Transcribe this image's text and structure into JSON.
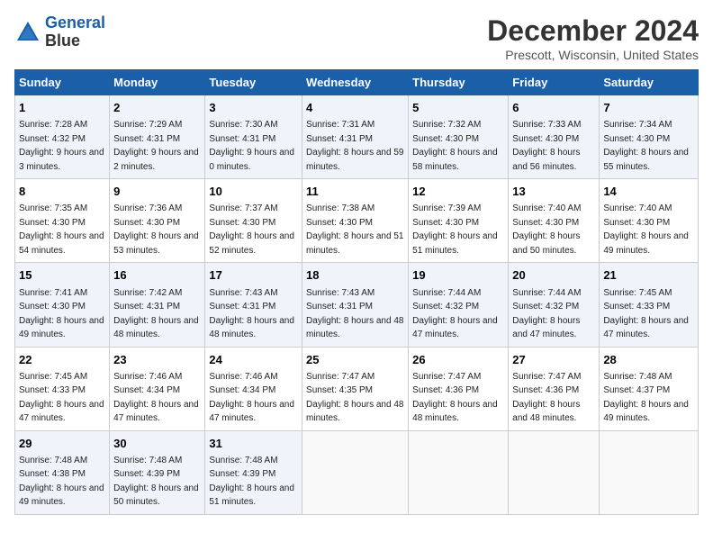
{
  "header": {
    "logo_line1": "General",
    "logo_line2": "Blue",
    "title": "December 2024",
    "subtitle": "Prescott, Wisconsin, United States"
  },
  "calendar": {
    "days_of_week": [
      "Sunday",
      "Monday",
      "Tuesday",
      "Wednesday",
      "Thursday",
      "Friday",
      "Saturday"
    ],
    "weeks": [
      [
        {
          "day": "1",
          "sunrise": "7:28 AM",
          "sunset": "4:32 PM",
          "daylight": "9 hours and 3 minutes."
        },
        {
          "day": "2",
          "sunrise": "7:29 AM",
          "sunset": "4:31 PM",
          "daylight": "9 hours and 2 minutes."
        },
        {
          "day": "3",
          "sunrise": "7:30 AM",
          "sunset": "4:31 PM",
          "daylight": "9 hours and 0 minutes."
        },
        {
          "day": "4",
          "sunrise": "7:31 AM",
          "sunset": "4:31 PM",
          "daylight": "8 hours and 59 minutes."
        },
        {
          "day": "5",
          "sunrise": "7:32 AM",
          "sunset": "4:30 PM",
          "daylight": "8 hours and 58 minutes."
        },
        {
          "day": "6",
          "sunrise": "7:33 AM",
          "sunset": "4:30 PM",
          "daylight": "8 hours and 56 minutes."
        },
        {
          "day": "7",
          "sunrise": "7:34 AM",
          "sunset": "4:30 PM",
          "daylight": "8 hours and 55 minutes."
        }
      ],
      [
        {
          "day": "8",
          "sunrise": "7:35 AM",
          "sunset": "4:30 PM",
          "daylight": "8 hours and 54 minutes."
        },
        {
          "day": "9",
          "sunrise": "7:36 AM",
          "sunset": "4:30 PM",
          "daylight": "8 hours and 53 minutes."
        },
        {
          "day": "10",
          "sunrise": "7:37 AM",
          "sunset": "4:30 PM",
          "daylight": "8 hours and 52 minutes."
        },
        {
          "day": "11",
          "sunrise": "7:38 AM",
          "sunset": "4:30 PM",
          "daylight": "8 hours and 51 minutes."
        },
        {
          "day": "12",
          "sunrise": "7:39 AM",
          "sunset": "4:30 PM",
          "daylight": "8 hours and 51 minutes."
        },
        {
          "day": "13",
          "sunrise": "7:40 AM",
          "sunset": "4:30 PM",
          "daylight": "8 hours and 50 minutes."
        },
        {
          "day": "14",
          "sunrise": "7:40 AM",
          "sunset": "4:30 PM",
          "daylight": "8 hours and 49 minutes."
        }
      ],
      [
        {
          "day": "15",
          "sunrise": "7:41 AM",
          "sunset": "4:30 PM",
          "daylight": "8 hours and 49 minutes."
        },
        {
          "day": "16",
          "sunrise": "7:42 AM",
          "sunset": "4:31 PM",
          "daylight": "8 hours and 48 minutes."
        },
        {
          "day": "17",
          "sunrise": "7:43 AM",
          "sunset": "4:31 PM",
          "daylight": "8 hours and 48 minutes."
        },
        {
          "day": "18",
          "sunrise": "7:43 AM",
          "sunset": "4:31 PM",
          "daylight": "8 hours and 48 minutes."
        },
        {
          "day": "19",
          "sunrise": "7:44 AM",
          "sunset": "4:32 PM",
          "daylight": "8 hours and 47 minutes."
        },
        {
          "day": "20",
          "sunrise": "7:44 AM",
          "sunset": "4:32 PM",
          "daylight": "8 hours and 47 minutes."
        },
        {
          "day": "21",
          "sunrise": "7:45 AM",
          "sunset": "4:33 PM",
          "daylight": "8 hours and 47 minutes."
        }
      ],
      [
        {
          "day": "22",
          "sunrise": "7:45 AM",
          "sunset": "4:33 PM",
          "daylight": "8 hours and 47 minutes."
        },
        {
          "day": "23",
          "sunrise": "7:46 AM",
          "sunset": "4:34 PM",
          "daylight": "8 hours and 47 minutes."
        },
        {
          "day": "24",
          "sunrise": "7:46 AM",
          "sunset": "4:34 PM",
          "daylight": "8 hours and 47 minutes."
        },
        {
          "day": "25",
          "sunrise": "7:47 AM",
          "sunset": "4:35 PM",
          "daylight": "8 hours and 48 minutes."
        },
        {
          "day": "26",
          "sunrise": "7:47 AM",
          "sunset": "4:36 PM",
          "daylight": "8 hours and 48 minutes."
        },
        {
          "day": "27",
          "sunrise": "7:47 AM",
          "sunset": "4:36 PM",
          "daylight": "8 hours and 48 minutes."
        },
        {
          "day": "28",
          "sunrise": "7:48 AM",
          "sunset": "4:37 PM",
          "daylight": "8 hours and 49 minutes."
        }
      ],
      [
        {
          "day": "29",
          "sunrise": "7:48 AM",
          "sunset": "4:38 PM",
          "daylight": "8 hours and 49 minutes."
        },
        {
          "day": "30",
          "sunrise": "7:48 AM",
          "sunset": "4:39 PM",
          "daylight": "8 hours and 50 minutes."
        },
        {
          "day": "31",
          "sunrise": "7:48 AM",
          "sunset": "4:39 PM",
          "daylight": "8 hours and 51 minutes."
        },
        null,
        null,
        null,
        null
      ]
    ]
  }
}
